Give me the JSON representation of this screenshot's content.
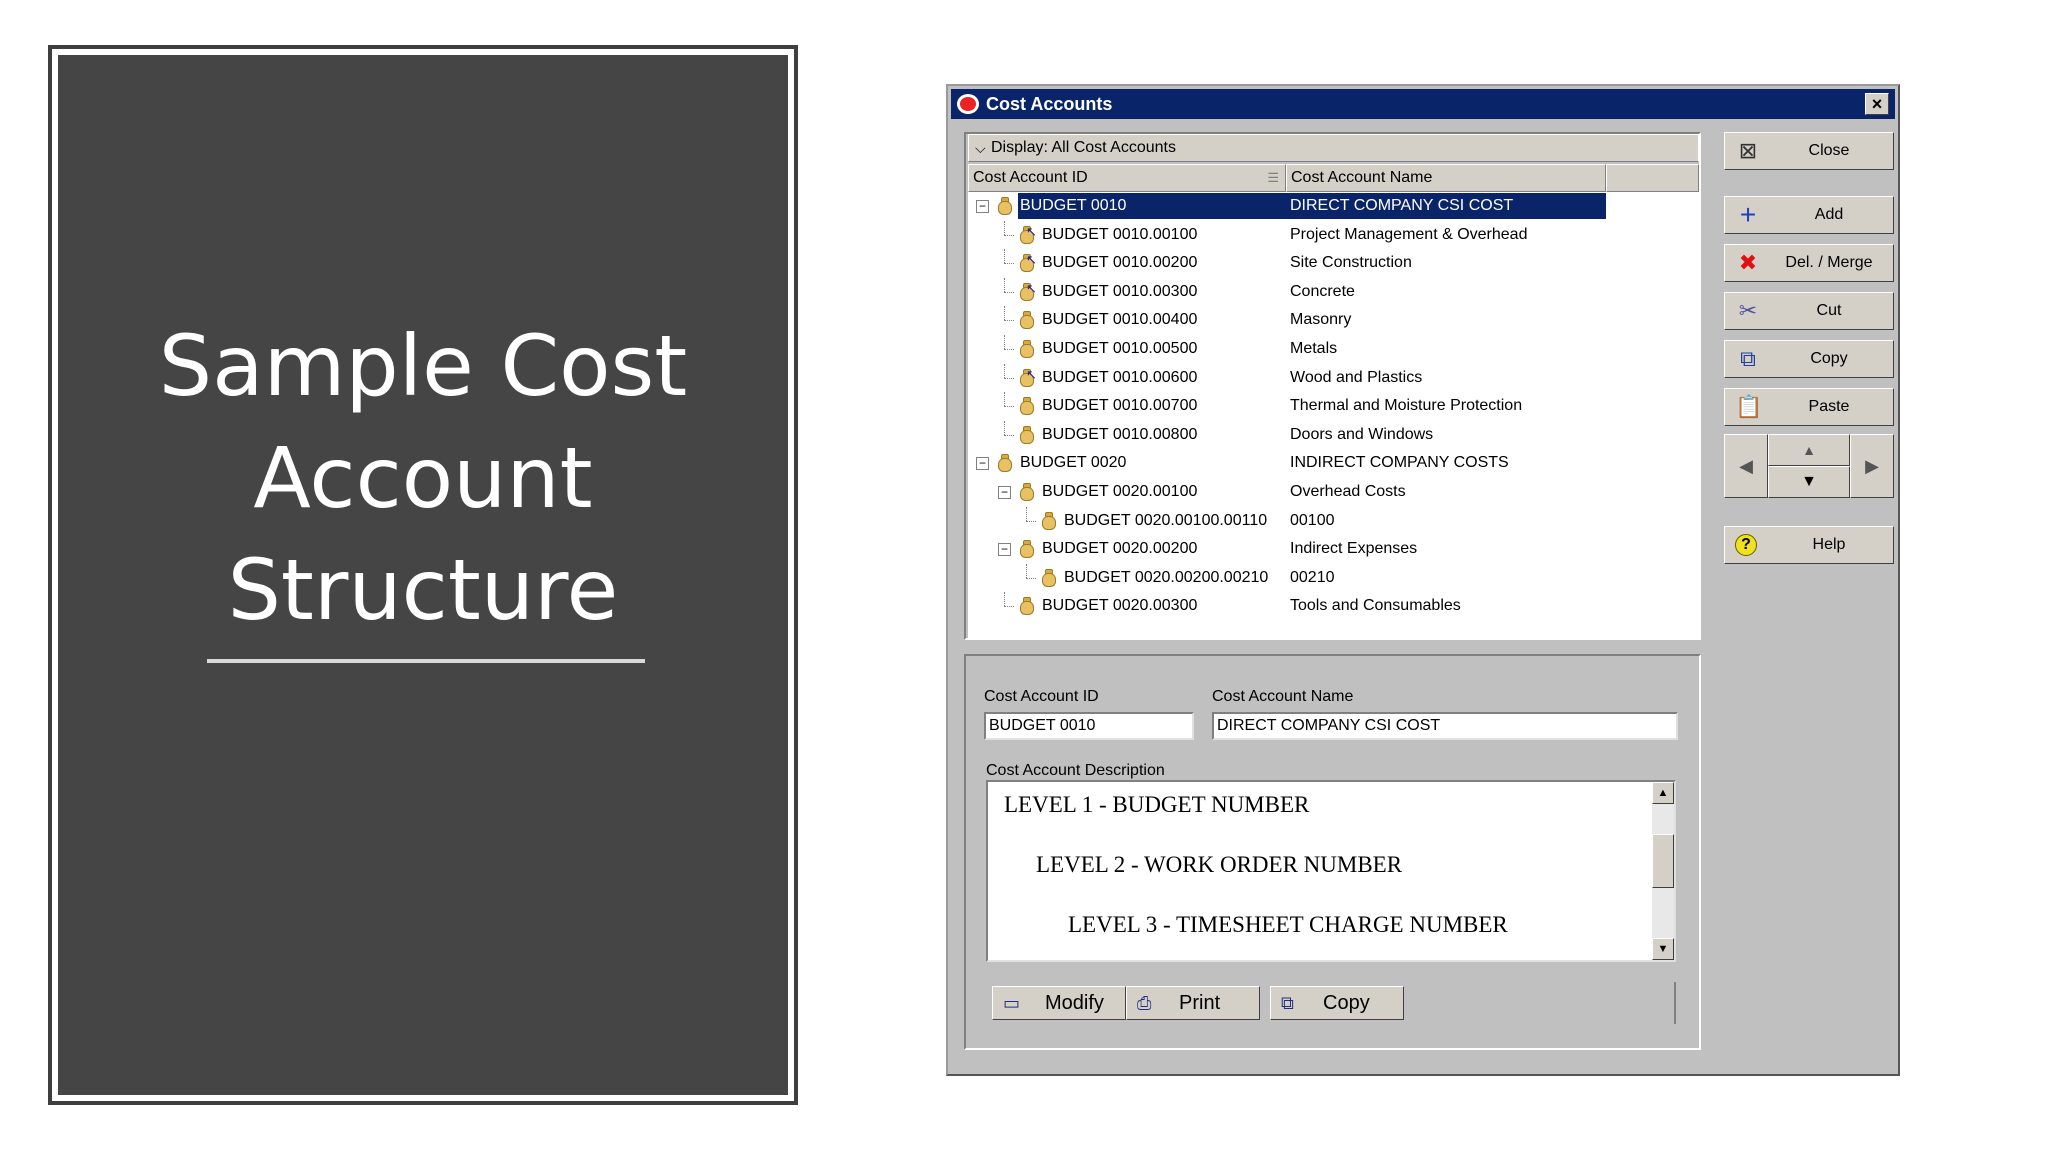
{
  "slide": {
    "title_lines": [
      "Sample Cost",
      "Account",
      "Structure"
    ]
  },
  "window": {
    "title": "Cost Accounts",
    "close_glyph": "×"
  },
  "tree": {
    "display_label": "Display: All Cost Accounts",
    "columns": [
      "Cost Account ID",
      "Cost Account Name"
    ],
    "rows": [
      {
        "id": "BUDGET 0010",
        "name": "DIRECT COMPANY CSI COST",
        "level": 0,
        "expander": "minus",
        "selected": true,
        "icon": "money-bag-icon"
      },
      {
        "id": "BUDGET 0010.00100",
        "name": "Project Management & Overhead",
        "level": 1,
        "icon": "money-bag-cursor-icon"
      },
      {
        "id": "BUDGET 0010.00200",
        "name": "Site Construction",
        "level": 1,
        "icon": "money-bag-cursor-icon"
      },
      {
        "id": "BUDGET 0010.00300",
        "name": "Concrete",
        "level": 1,
        "icon": "money-bag-cursor-icon"
      },
      {
        "id": "BUDGET 0010.00400",
        "name": "Masonry",
        "level": 1,
        "icon": "money-bag-icon"
      },
      {
        "id": "BUDGET 0010.00500",
        "name": "Metals",
        "level": 1,
        "icon": "money-bag-icon"
      },
      {
        "id": "BUDGET 0010.00600",
        "name": "Wood and Plastics",
        "level": 1,
        "icon": "money-bag-cursor-icon"
      },
      {
        "id": "BUDGET 0010.00700",
        "name": "Thermal and Moisture Protection",
        "level": 1,
        "icon": "money-bag-icon"
      },
      {
        "id": "BUDGET 0010.00800",
        "name": "Doors and Windows",
        "level": 1,
        "icon": "money-bag-icon"
      },
      {
        "id": "BUDGET 0020",
        "name": "INDIRECT COMPANY COSTS",
        "level": 0,
        "expander": "minus",
        "icon": "money-bag-icon"
      },
      {
        "id": "BUDGET 0020.00100",
        "name": "Overhead Costs",
        "level": 1,
        "expander": "minus",
        "icon": "money-bag-icon"
      },
      {
        "id": "BUDGET 0020.00100.00110",
        "name": "00100",
        "level": 2,
        "icon": "money-bag-icon"
      },
      {
        "id": "BUDGET 0020.00200",
        "name": "Indirect Expenses",
        "level": 1,
        "expander": "minus",
        "icon": "money-bag-icon"
      },
      {
        "id": "BUDGET 0020.00200.00210",
        "name": "00210",
        "level": 2,
        "icon": "money-bag-icon"
      },
      {
        "id": "BUDGET 0020.00300",
        "name": "Tools and Consumables",
        "level": 1,
        "icon": "money-bag-icon"
      }
    ]
  },
  "detail": {
    "id_label": "Cost Account ID",
    "id_value": "BUDGET 0010",
    "name_label": "Cost Account Name",
    "name_value": "DIRECT COMPANY CSI COST",
    "desc_label": "Cost Account Description",
    "desc_lines": [
      "LEVEL 1 - BUDGET NUMBER",
      "LEVEL 2 - WORK ORDER NUMBER",
      "LEVEL 3 - TIMESHEET CHARGE NUMBER"
    ],
    "buttons": [
      {
        "name": "modify-button",
        "icon": "monitor-icon",
        "glyph": "▭",
        "label": "Modify"
      },
      {
        "name": "print-button",
        "icon": "printer-icon",
        "glyph": "⎙",
        "label": "Print"
      },
      {
        "name": "copy-desc-button",
        "icon": "copy-icon",
        "glyph": "⧉",
        "label": "Copy"
      }
    ]
  },
  "side_buttons": [
    {
      "name": "close-button",
      "icon": "close-window-icon",
      "glyph": "⊠",
      "color": "#303030",
      "label": "Close"
    },
    {
      "name": "add-button",
      "icon": "plus-icon",
      "glyph": "+",
      "color": "#2040c0",
      "label": "Add"
    },
    {
      "name": "delete-merge-button",
      "icon": "red-x-icon",
      "glyph": "✖",
      "color": "#e01010",
      "label": "Del. / Merge"
    },
    {
      "name": "cut-button",
      "icon": "scissors-icon",
      "glyph": "✂",
      "color": "#5050a0",
      "label": "Cut"
    },
    {
      "name": "copy-button",
      "icon": "copy-icon",
      "glyph": "⧉",
      "color": "#2040a0",
      "label": "Copy"
    },
    {
      "name": "paste-button",
      "icon": "clipboard-icon",
      "glyph": "📋",
      "color": "#a08020",
      "label": "Paste"
    },
    {
      "name": "help-button",
      "icon": "help-icon",
      "glyph": "?",
      "color": "#000000",
      "label": "Help"
    }
  ]
}
